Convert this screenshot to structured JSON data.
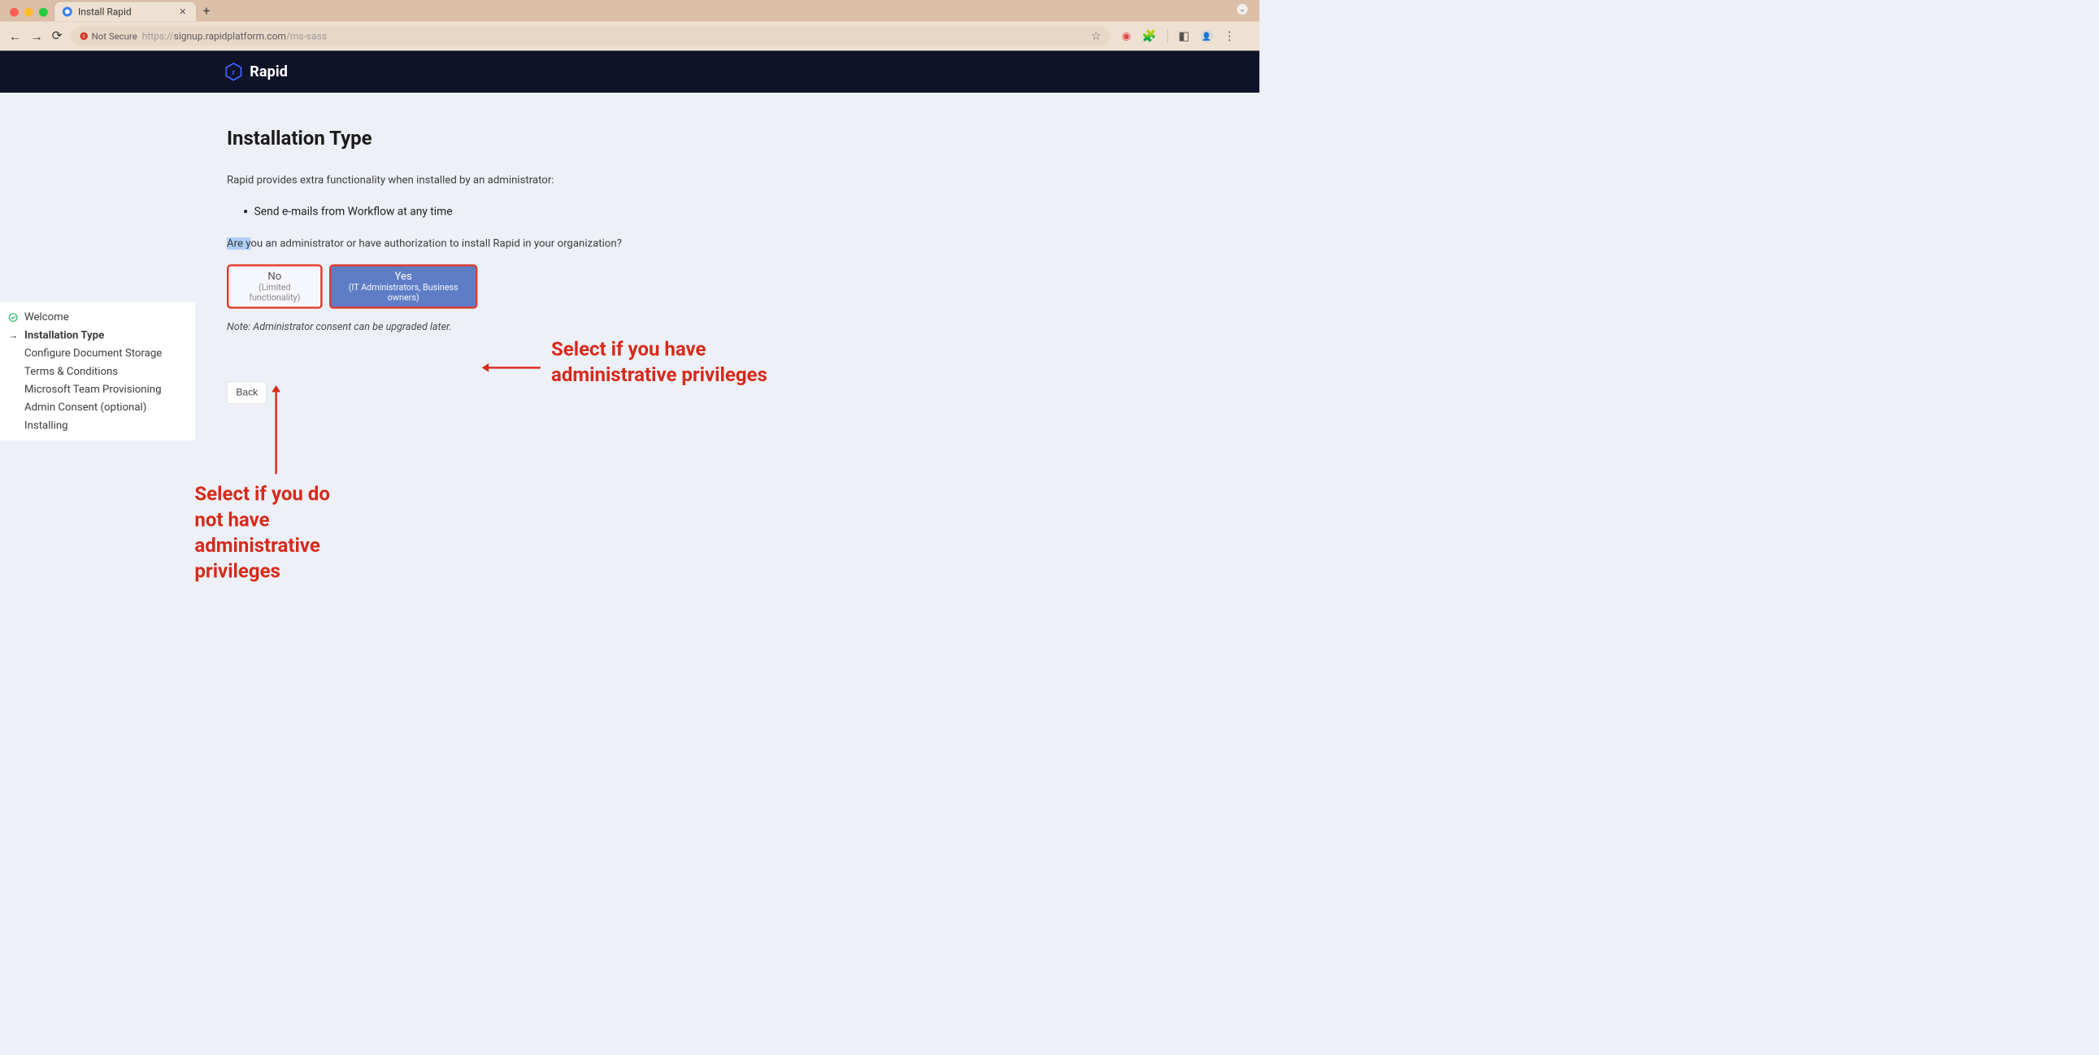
{
  "browser": {
    "tab_title": "Install Rapid",
    "not_secure": "Not Secure",
    "url_scheme": "https://",
    "url_host": "signup.rapidplatform.com",
    "url_path": "/ms-sass"
  },
  "header": {
    "brand": "Rapid"
  },
  "sidebar": {
    "items": [
      {
        "label": "Welcome",
        "state": "done"
      },
      {
        "label": "Installation Type",
        "state": "active"
      },
      {
        "label": "Configure Document Storage",
        "state": ""
      },
      {
        "label": "Terms & Conditions",
        "state": ""
      },
      {
        "label": "Microsoft Team Provisioning",
        "state": ""
      },
      {
        "label": "Admin Consent (optional)",
        "state": ""
      },
      {
        "label": "Installing",
        "state": ""
      }
    ]
  },
  "main": {
    "title": "Installation Type",
    "intro": "Rapid provides extra functionality when installed by an administrator:",
    "bullet_1": "Send e-mails from Workflow at any time",
    "question_pre_hl": "Are y",
    "question_post_hl": "ou an administrator or have authorization to install Rapid in your organization?",
    "opt_no_title": "No",
    "opt_no_sub": "(Limited functionality)",
    "opt_yes_title": "Yes",
    "opt_yes_sub": "(IT Administrators, Business owners)",
    "note": "Note: Administrator consent can be upgraded later.",
    "back_label": "Back"
  },
  "annotations": {
    "right": "Select if you have administrative privileges",
    "bottom": "Select if you do not have administrative privileges"
  },
  "colors": {
    "annotation": "#d62a1b",
    "header_bg": "#0f1328",
    "yes_bg": "#5f7dc7",
    "no_border": "#e03a2b"
  }
}
